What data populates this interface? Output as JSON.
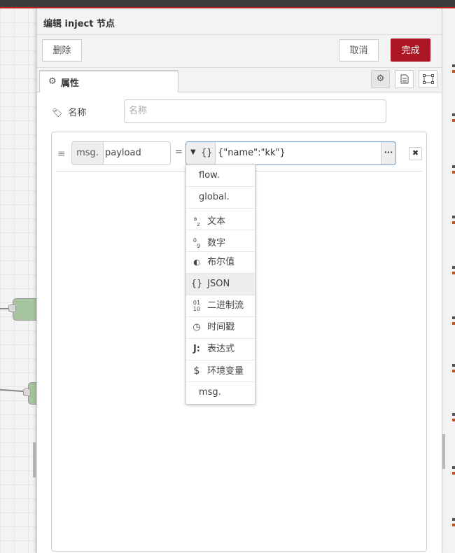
{
  "tray": {
    "title": "编辑 inject 节点",
    "delete_label": "删除",
    "cancel_label": "取消",
    "done_label": "完成",
    "tab_label": "属性"
  },
  "name_field": {
    "label": "名称",
    "placeholder": "名称",
    "value": ""
  },
  "property": {
    "prefix": "msg.",
    "key": "payload",
    "equals": "=",
    "type_icon": "{}",
    "value": "{\"name\":\"kk\"}",
    "expand": "···",
    "remove": "✖"
  },
  "dropdown": {
    "items": [
      {
        "label": "flow.",
        "icon": ""
      },
      {
        "label": "global.",
        "icon": ""
      },
      {
        "label": "文本",
        "icon": "az-icon"
      },
      {
        "label": "数字",
        "icon": "09-icon"
      },
      {
        "label": "布尔值",
        "icon": "bool-icon"
      },
      {
        "label": "JSON",
        "icon": "json-icon"
      },
      {
        "label": "二进制流",
        "icon": "bin-icon"
      },
      {
        "label": "时间戳",
        "icon": "clock-icon"
      },
      {
        "label": "表达式",
        "icon": "jsonata-icon"
      },
      {
        "label": "环境变量",
        "icon": "dollar-icon"
      },
      {
        "label": "msg.",
        "icon": ""
      }
    ],
    "selected": "JSON"
  },
  "colors": {
    "accent": "#ad1625",
    "focus_border": "#6b9bd1"
  }
}
